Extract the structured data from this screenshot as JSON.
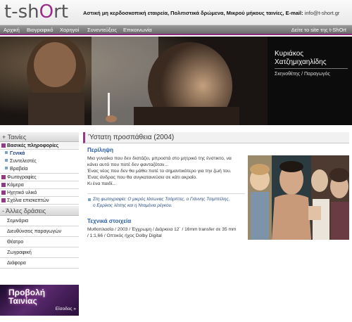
{
  "header": {
    "logo_main": "t-sh",
    "logo_accent": "O",
    "logo_end": "rt",
    "tagline": "Αστική μη κερδοσκοπική εταιρεία, Πολιτιστικά δρώμενα, Μικρού μήκους ταινίες, E-mail:",
    "email": "info@t-short.gr"
  },
  "nav": {
    "items": [
      "Αρχική",
      "Βιογραφικό",
      "Χορηγοί",
      "Συνεντεύξεις",
      "Επικοινωνία"
    ],
    "right_link": "Δείτε το site της t-ShOrt"
  },
  "banner": {
    "name_line1": "Κυριάκος",
    "name_line2": "Χατζημιχαηλίδης",
    "role": "Σκηνοθέτης / Παραγωγός"
  },
  "sidebar": {
    "films_header": "+ Ταινίες",
    "basic_info": "Βασικές πληροφορίες",
    "sub_items": [
      "Γενικά",
      "Συντελεστές",
      "Βραβεία"
    ],
    "items": [
      "Φωτογραφίες",
      "Κάμερα",
      "Ηχητικό υλικό",
      "Σχόλια επισκεπτών"
    ],
    "other_header": "- Άλλες δράσεις",
    "other_items": [
      "Σεμινάρια",
      "Διευθύνσεις παραγωγών",
      "Θέατρο",
      "Ζωγραφική",
      "Διάφορα"
    ],
    "promo_line1": "Προβολή",
    "promo_line2": "Ταινίας",
    "promo_enter": "Είσοδος »"
  },
  "main": {
    "title": "Ύστατη προσπάθεια (2004)",
    "summary_heading": "Περίληψη",
    "summary_lines": [
      "Μια γυναίκα που δεν διστάζει, μπροστά στο μητρικό της ένστικτο, να",
      "κάνει αυτό που ποτέ δεν φανταζόταν...",
      "Ένας νέος που δεν θα μάθει ποτέ το σημαντικότερο για την ζωή του.",
      "Ένας άνδρας που θα συγκατανεύσει σε κάτι ακραίο.",
      "Κι ένα παιδί..."
    ],
    "caption_lines": [
      "Στη φωτογραφία: Ο μικρός Ιάσωνας Τσάρπτες, ο Γιάννης Τσιμπτέλης,",
      "ο Ερρίκος λίτσης και η Νταμένια ρέγκου."
    ],
    "tech_heading": "Τεχνικά στοιχεία",
    "tech_lines": [
      "Μυθοπλασία / 2003 / Έγχρωμη / Διάρκεια 12´ / 16mm transfer σε 35 mm",
      "/ 1:1,66 / Οπτικός ήχος Dolby Digital"
    ]
  },
  "colors": {
    "accent": "#8f3b86",
    "heading_blue": "#2b5fa6"
  }
}
